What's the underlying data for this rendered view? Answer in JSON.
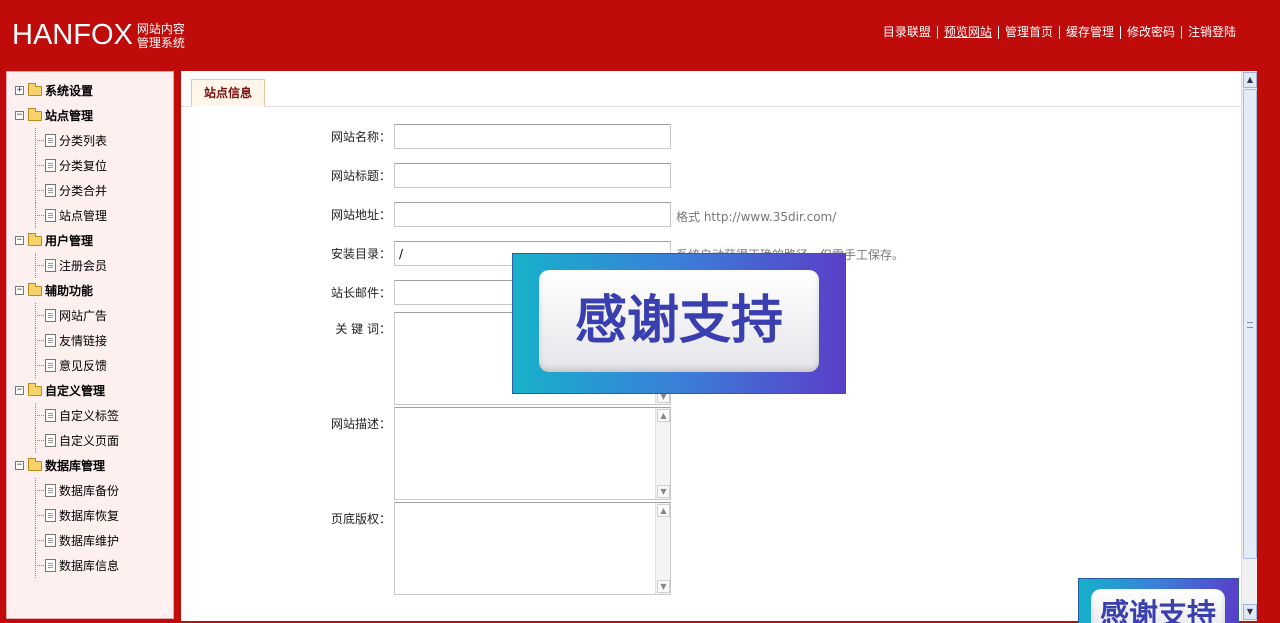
{
  "header": {
    "logo_main": "HANFOX",
    "logo_sub_line1": "网站内容",
    "logo_sub_line2": "管理系统",
    "nav": [
      "目录联盟",
      "预览网站",
      "管理首页",
      "缓存管理",
      "修改密码",
      "注销登陆"
    ]
  },
  "sidebar": {
    "groups": [
      {
        "label": "系统设置",
        "expanded": false,
        "items": []
      },
      {
        "label": "站点管理",
        "expanded": true,
        "items": [
          "分类列表",
          "分类复位",
          "分类合并",
          "站点管理"
        ]
      },
      {
        "label": "用户管理",
        "expanded": true,
        "items": [
          "注册会员"
        ]
      },
      {
        "label": "辅助功能",
        "expanded": true,
        "items": [
          "网站广告",
          "友情链接",
          "意见反馈"
        ]
      },
      {
        "label": "自定义管理",
        "expanded": true,
        "items": [
          "自定义标签",
          "自定义页面"
        ]
      },
      {
        "label": "数据库管理",
        "expanded": true,
        "items": [
          "数据库备份",
          "数据库恢复",
          "数据库维护",
          "数据库信息"
        ]
      }
    ]
  },
  "main": {
    "tab": "站点信息",
    "form": {
      "site_name_label": "网站名称：",
      "site_title_label": "网站标题：",
      "site_url_label": "网站地址：",
      "site_url_hint": "格式  http://www.35dir.com/",
      "install_dir_label": "安装目录：",
      "install_dir_value": "/",
      "install_dir_hint": "系统自动获得正确的路径，但需手工保存。",
      "admin_email_label": "站长邮件：",
      "keywords_label": "关 键 词：",
      "description_label": "网站描述：",
      "copyright_label": "页底版权："
    }
  },
  "overlay": {
    "badge_text": "感谢支持"
  },
  "colors": {
    "header_bg": "#c00b0b",
    "sidebar_bg": "#fff0f0",
    "tab_text": "#7a1010"
  }
}
